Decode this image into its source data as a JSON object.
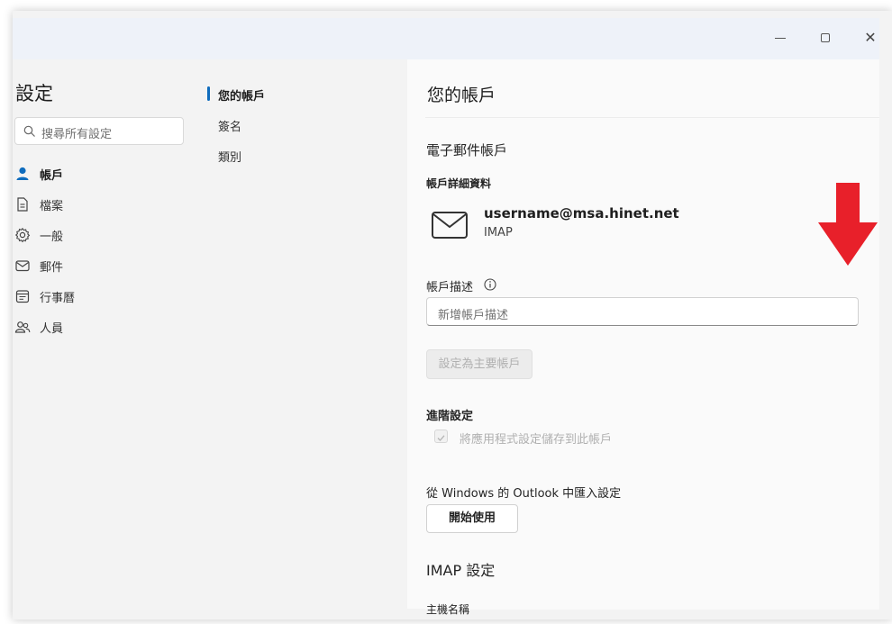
{
  "window": {
    "controls": {
      "minimize": "minimize-icon",
      "maximize": "maximize-icon",
      "close": "close-icon"
    }
  },
  "nav": {
    "title": "設定",
    "search_placeholder": "搜尋所有設定",
    "items": [
      {
        "label": "帳戶",
        "icon": "person-icon",
        "active": true
      },
      {
        "label": "檔案",
        "icon": "document-icon",
        "active": false
      },
      {
        "label": "一般",
        "icon": "gear-icon",
        "active": false
      },
      {
        "label": "郵件",
        "icon": "mail-icon",
        "active": false
      },
      {
        "label": "行事曆",
        "icon": "calendar-icon",
        "active": false
      },
      {
        "label": "人員",
        "icon": "people-icon",
        "active": false
      }
    ]
  },
  "subnav": {
    "items": [
      {
        "label": "您的帳戶",
        "active": true
      },
      {
        "label": "簽名",
        "active": false
      },
      {
        "label": "類別",
        "active": false
      }
    ]
  },
  "content": {
    "title": "您的帳戶",
    "email_section_title": "電子郵件帳戶",
    "account_details_title": "帳戶詳細資料",
    "account": {
      "email": "username@msa.hinet.net",
      "type": "IMAP"
    },
    "description_label": "帳戶描述",
    "description_placeholder": "新增帳戶描述",
    "set_primary_button": "設定為主要帳戶",
    "advanced_title": "進階設定",
    "save_settings_checkbox": "將應用程式設定儲存到此帳戶",
    "import_label": "從 Windows 的 Outlook 中匯入設定",
    "start_button": "開始使用",
    "imap_title": "IMAP 設定",
    "host_label": "主機名稱"
  },
  "annotation": {
    "arrow_color": "#e8202a",
    "accent": "#0f6cbd"
  }
}
